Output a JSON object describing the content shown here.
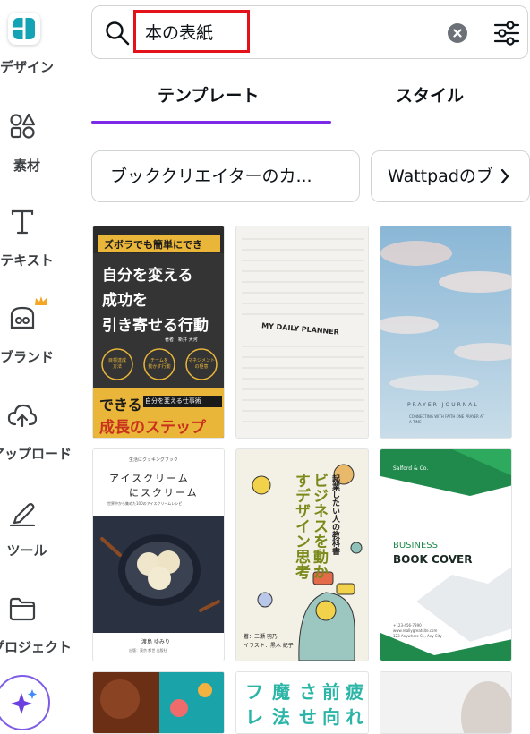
{
  "sidebar": {
    "items": [
      {
        "label": "デザイン"
      },
      {
        "label": "素材"
      },
      {
        "label": "テキスト"
      },
      {
        "label": "ブランド"
      },
      {
        "label": "アップロード"
      },
      {
        "label": "ツール"
      },
      {
        "label": "プロジェクト"
      }
    ]
  },
  "search": {
    "value": "本の表紙"
  },
  "tabs": [
    {
      "label": "テンプレート",
      "active": true
    },
    {
      "label": "スタイル",
      "active": false
    }
  ],
  "chips": [
    {
      "label": "ブッククリエイターのカ..."
    },
    {
      "label": "Wattpadのブ"
    }
  ],
  "templates": {
    "t1": {
      "banner": "ズボラでも簡単にでき",
      "title1": "自分を変える",
      "title2": "成功を",
      "title3": "引き寄せる行動",
      "author": "著者　新井 大河",
      "circle1": "目標達成\n方法",
      "circle2": "チームを\n動かす行動",
      "circle3": "マネジメント\nの極意",
      "bottom1": "できる",
      "bottom_tag": "自分を変える仕事術",
      "bottom2": "成長のステップ"
    },
    "t2": {
      "title": "MY DAILY PLANNER"
    },
    "t3": {
      "title": "PRAYER JOURNAL",
      "sub": "CONNECTING WITH FAITH ONE PRAYER AT A TIME"
    },
    "t4": {
      "top": "生活にクッキングブック",
      "title1": "アイスクリーム",
      "title2": "にスクリーム",
      "subtitle": "世界中から集めた100のアイスクリームレシピ",
      "author": "渡島 ゆみり",
      "publisher": "出版：東京 都世 出版社"
    },
    "t5": {
      "title": "ビジネスを動かすデザイン思考",
      "side": "起業したい人の教科書",
      "author": "著：三瀬 羽乃",
      "illust": "イラスト：黒木 紀子"
    },
    "t6": {
      "brand": "Salford & Co.",
      "title1": "BUSINESS",
      "title2": "BOOK COVER",
      "contact1": "+123-456-7890",
      "contact2": "www.reallygreatsite.com",
      "contact3": "123 Anywhere St., Any City"
    },
    "t8": {
      "cols": [
        "疲",
        "前",
        "さ",
        "魔",
        "フ"
      ],
      "cols2": [
        "れ",
        "向",
        "せ",
        "法",
        "レ"
      ]
    }
  },
  "colors": {
    "accent": "#7d2ae8",
    "highlight": "#e3111a",
    "text": "#0e1318"
  }
}
